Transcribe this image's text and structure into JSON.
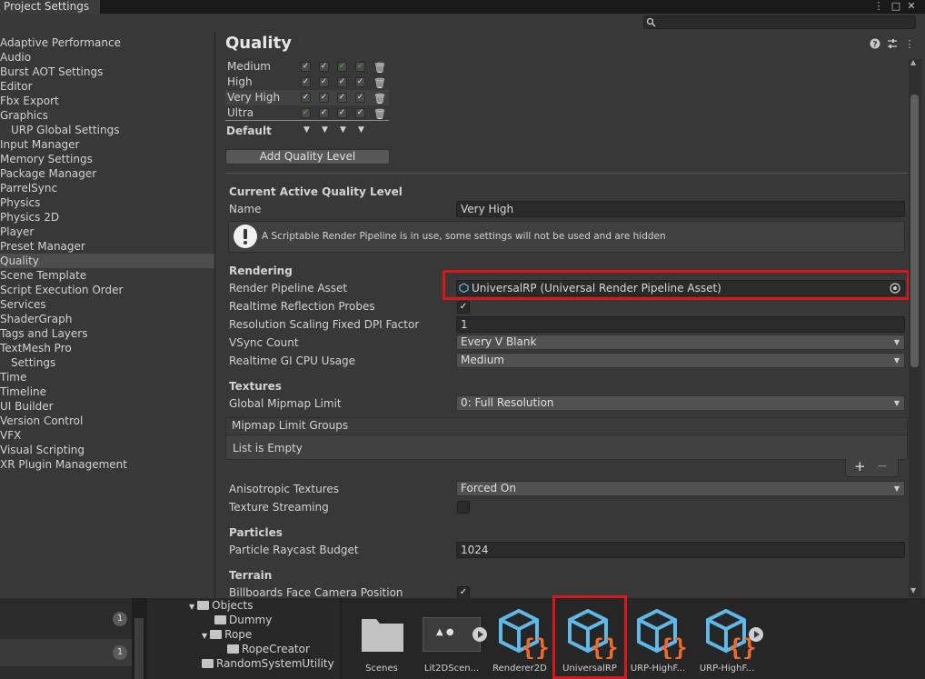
{
  "window": {
    "tab_title": "Project Settings",
    "menu_icon": "⋮",
    "maximize_icon": "□",
    "close_icon": "✕"
  },
  "sidebar": {
    "items": [
      {
        "label": "Adaptive Performance"
      },
      {
        "label": "Audio"
      },
      {
        "label": "Burst AOT Settings"
      },
      {
        "label": "Editor"
      },
      {
        "label": "Fbx Export"
      },
      {
        "label": "Graphics"
      },
      {
        "label": "URP Global Settings"
      },
      {
        "label": "Input Manager"
      },
      {
        "label": "Memory Settings"
      },
      {
        "label": "Package Manager"
      },
      {
        "label": "ParrelSync"
      },
      {
        "label": "Physics"
      },
      {
        "label": "Physics 2D"
      },
      {
        "label": "Player"
      },
      {
        "label": "Preset Manager"
      },
      {
        "label": "Quality"
      },
      {
        "label": "Scene Template"
      },
      {
        "label": "Script Execution Order"
      },
      {
        "label": "Services"
      },
      {
        "label": "ShaderGraph"
      },
      {
        "label": "Tags and Layers"
      },
      {
        "label": "TextMesh Pro"
      },
      {
        "label": "Settings"
      },
      {
        "label": "Time"
      },
      {
        "label": "Timeline"
      },
      {
        "label": "UI Builder"
      },
      {
        "label": "Version Control"
      },
      {
        "label": "VFX"
      },
      {
        "label": "Visual Scripting"
      },
      {
        "label": "XR Plugin Management"
      }
    ]
  },
  "quality": {
    "title": "Quality",
    "levels": [
      {
        "name": "Medium"
      },
      {
        "name": "High"
      },
      {
        "name": "Very High"
      },
      {
        "name": "Ultra"
      }
    ],
    "default_label": "Default",
    "add_button": "Add Quality Level",
    "current_header": "Current Active Quality Level",
    "name_label": "Name",
    "name_value": "Very High",
    "info_text": "A Scriptable Render Pipeline is in use, some settings will not be used and are hidden",
    "rendering": {
      "header": "Rendering",
      "pipeline_label": "Render Pipeline Asset",
      "pipeline_value": "UniversalRP (Universal Render Pipeline Asset)",
      "reflection_label": "Realtime Reflection Probes",
      "reflection_checked": true,
      "dpi_label": "Resolution Scaling Fixed DPI Factor",
      "dpi_value": "1",
      "vsync_label": "VSync Count",
      "vsync_value": "Every V Blank",
      "gi_label": "Realtime GI CPU Usage",
      "gi_value": "Medium"
    },
    "textures": {
      "header": "Textures",
      "mipmap_label": "Global Mipmap Limit",
      "mipmap_value": "0: Full Resolution",
      "groups_label": "Mipmap Limit Groups",
      "groups_empty": "List is Empty",
      "add_symbol": "+",
      "remove_symbol": "−",
      "aniso_label": "Anisotropic Textures",
      "aniso_value": "Forced On",
      "streaming_label": "Texture Streaming",
      "streaming_checked": false
    },
    "particles": {
      "header": "Particles",
      "raycast_label": "Particle Raycast Budget",
      "raycast_value": "1024"
    },
    "terrain": {
      "header": "Terrain",
      "billboards_label": "Billboards Face Camera Position",
      "billboards_checked": true
    }
  },
  "bottom": {
    "badges": [
      "1",
      "1"
    ],
    "tree": [
      {
        "label": "Objects"
      },
      {
        "label": "Dummy"
      },
      {
        "label": "Rope"
      },
      {
        "label": "RopeCreator"
      },
      {
        "label": "RandomSystemUtility"
      }
    ],
    "assets": [
      {
        "label": "Scenes"
      },
      {
        "label": "Lit2DScen..."
      },
      {
        "label": "Renderer2D"
      },
      {
        "label": "UniversalRP"
      },
      {
        "label": "URP-HighF..."
      },
      {
        "label": "URP-HighF..."
      }
    ]
  },
  "colors": {
    "highlight": "#d9161c",
    "asset_blue": "#5fb8e6",
    "asset_orange": "#f06a2a",
    "check_green": "#3ec43e"
  }
}
